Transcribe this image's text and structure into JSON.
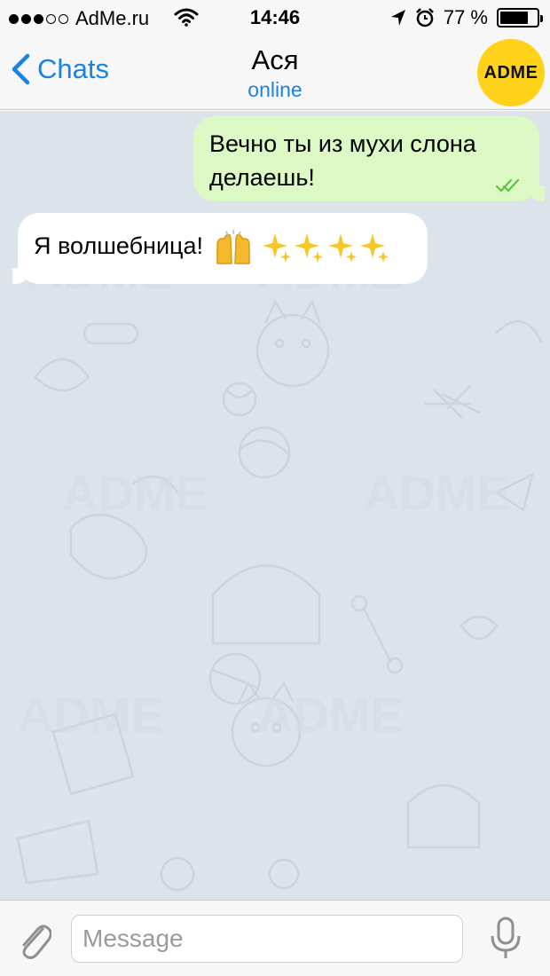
{
  "status_bar": {
    "carrier": "AdMe.ru",
    "signal_bars": 3,
    "signal_total": 5,
    "time": "14:46",
    "battery": "77 %",
    "battery_level": 0.77,
    "icons": [
      "wifi-icon",
      "location-arrow-icon",
      "alarm-clock-icon",
      "battery-icon"
    ]
  },
  "nav": {
    "back_label": "Chats",
    "title": "Ася",
    "subtitle": "online",
    "avatar_text": "ADME",
    "accent": "#1a82e2",
    "avatar_color": "#ffd21a"
  },
  "messages": [
    {
      "direction": "outgoing",
      "text": "Вечно ты из мухи слона делаешь!",
      "status": "read"
    },
    {
      "direction": "incoming",
      "text": "Я волшебница!",
      "emoji": [
        "raising-hands",
        "sparkles",
        "sparkles",
        "sparkles",
        "sparkles"
      ]
    }
  ],
  "input": {
    "placeholder": "Message",
    "value": ""
  },
  "watermark": "ADME",
  "colors": {
    "chat_background": "#dde3ea",
    "outgoing_bubble": "#dcf8c5",
    "incoming_bubble": "#ffffff",
    "read_checks": "#5ec24a"
  }
}
